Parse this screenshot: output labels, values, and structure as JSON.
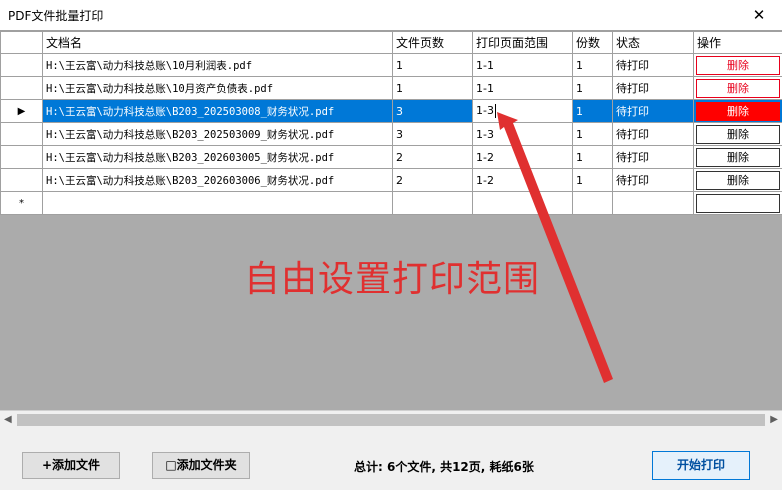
{
  "window": {
    "title": "PDF文件批量打印",
    "close_glyph": "✕"
  },
  "grid": {
    "columns": [
      "文档名",
      "文件页数",
      "打印页面范围",
      "份数",
      "状态",
      "操作"
    ],
    "rows": [
      {
        "name": "H:\\王云富\\动力科技总账\\10月利润表.pdf",
        "pages": "1",
        "range": "1-1",
        "copies": "1",
        "status": "待打印",
        "action": "删除"
      },
      {
        "name": "H:\\王云富\\动力科技总账\\10月资产负债表.pdf",
        "pages": "1",
        "range": "1-1",
        "copies": "1",
        "status": "待打印",
        "action": "删除"
      },
      {
        "name": "H:\\王云富\\动力科技总账\\B203_202503008_财务状况.pdf",
        "pages": "3",
        "range": "1-3",
        "copies": "1",
        "status": "待打印",
        "action": "删除"
      },
      {
        "name": "H:\\王云富\\动力科技总账\\B203_202503009_财务状况.pdf",
        "pages": "3",
        "range": "1-3",
        "copies": "1",
        "status": "待打印",
        "action": "删除"
      },
      {
        "name": "H:\\王云富\\动力科技总账\\B203_202603005_财务状况.pdf",
        "pages": "2",
        "range": "1-2",
        "copies": "1",
        "status": "待打印",
        "action": "删除"
      },
      {
        "name": "H:\\王云富\\动力科技总账\\B203_202603006_财务状况.pdf",
        "pages": "2",
        "range": "1-2",
        "copies": "1",
        "status": "待打印",
        "action": "删除"
      }
    ],
    "current_row_glyph": "▶",
    "new_row_glyph": "*"
  },
  "annotation": {
    "text": "自由设置打印范围",
    "color": "#e03030"
  },
  "footer": {
    "add_file": "+添加文件",
    "add_folder": "□添加文件夹",
    "summary": "总计: 6个文件, 共12页, 耗纸6张",
    "start": "开始打印"
  },
  "colors": {
    "selection": "#0078d7",
    "delete_red": "#ff0000",
    "grid_bg": "#ababab"
  }
}
